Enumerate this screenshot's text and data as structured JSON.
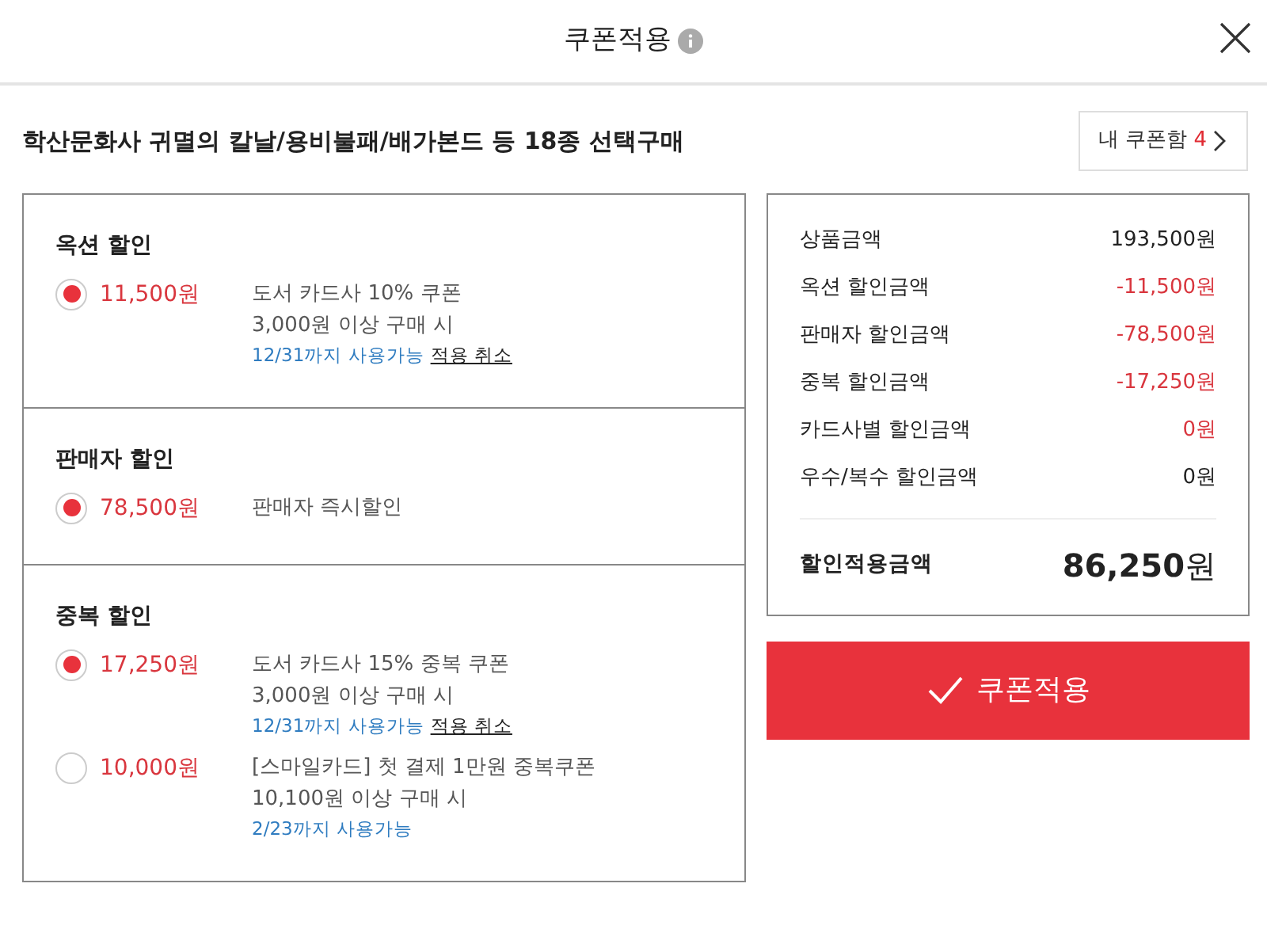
{
  "window": {
    "title": "쿠폰적용"
  },
  "product": {
    "title": "학산문화사 귀멸의 칼날/용비불패/배가본드 등 18종 선택구매",
    "coupon_box": {
      "label": "내 쿠폰함",
      "count": "4"
    }
  },
  "sections": [
    {
      "title": "옥션 할인",
      "coupons": [
        {
          "selected": true,
          "amount": "11,500원",
          "name": "도서 카드사 10% 쿠폰",
          "condition": "3,000원 이상 구매 시",
          "expiry": "12/31까지 사용가능",
          "cancel": "적용 취소"
        }
      ]
    },
    {
      "title": "판매자 할인",
      "coupons": [
        {
          "selected": true,
          "amount": "78,500원",
          "name": "판매자 즉시할인"
        }
      ]
    },
    {
      "title": "중복 할인",
      "coupons": [
        {
          "selected": true,
          "amount": "17,250원",
          "name": "도서 카드사 15% 중복 쿠폰",
          "condition": "3,000원 이상 구매 시",
          "expiry": "12/31까지 사용가능",
          "cancel": "적용 취소"
        },
        {
          "selected": false,
          "amount": "10,000원",
          "name": "[스마일카드] 첫 결제 1만원 중복쿠폰",
          "condition": "10,100원 이상 구매 시",
          "expiry": "2/23까지 사용가능"
        }
      ]
    }
  ],
  "summary": {
    "rows": [
      {
        "label": "상품금액",
        "value": "193,500원",
        "kind": "plain"
      },
      {
        "label": "옥션 할인금액",
        "value": "-11,500원",
        "kind": "discount"
      },
      {
        "label": "판매자 할인금액",
        "value": "-78,500원",
        "kind": "discount"
      },
      {
        "label": "중복 할인금액",
        "value": "-17,250원",
        "kind": "discount"
      },
      {
        "label": "카드사별 할인금액",
        "value": "0원",
        "kind": "discount"
      },
      {
        "label": "우수/복수 할인금액",
        "value": "0원",
        "kind": "plain"
      }
    ],
    "total_label": "할인적용금액",
    "total_value": "**86,250**원"
  },
  "apply_button": "쿠폰적용"
}
